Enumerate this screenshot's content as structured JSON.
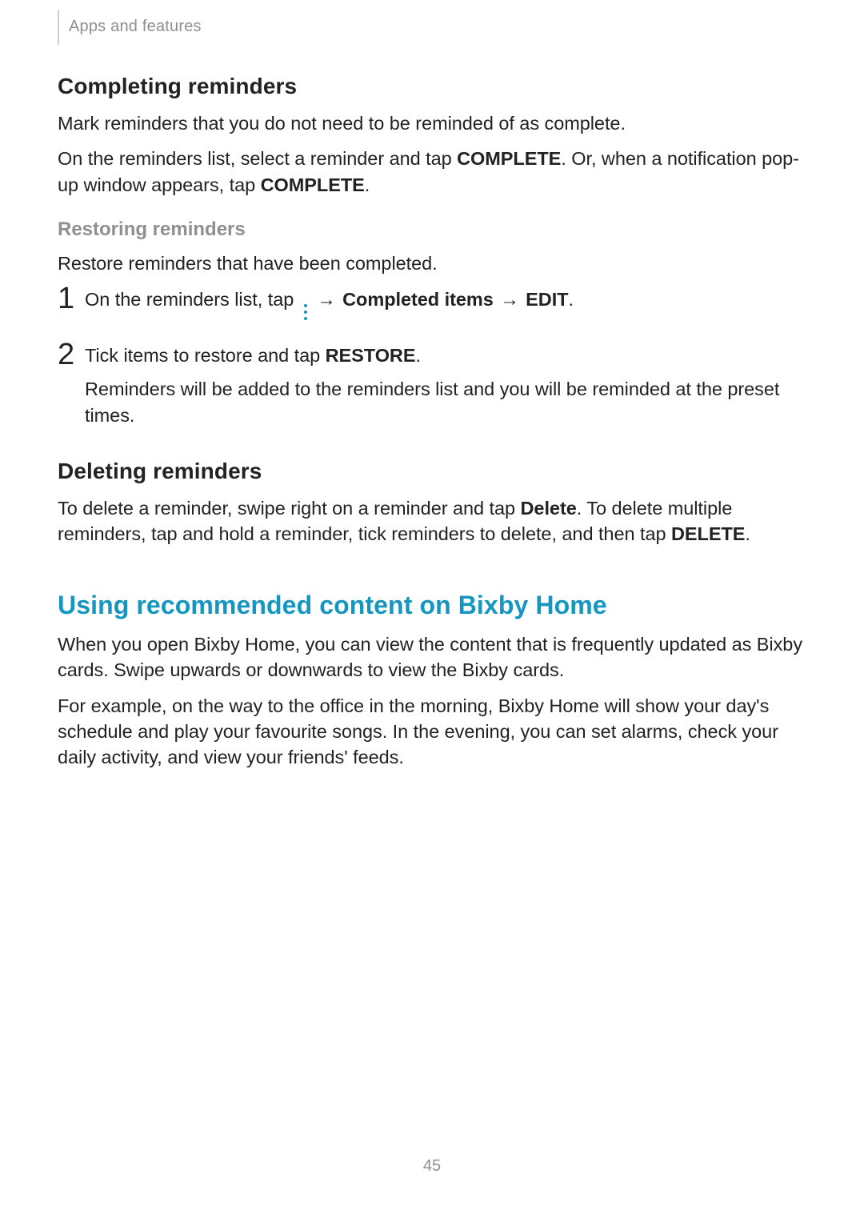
{
  "header": {
    "breadcrumb": "Apps and features"
  },
  "section_completing": {
    "title": "Completing reminders",
    "para1_pre": "Mark reminders that you do not need to be reminded of as complete.",
    "para2_pre": "On the reminders list, select a reminder and tap ",
    "para2_bold1": "COMPLETE",
    "para2_mid": ". Or, when a notification pop-up window appears, tap ",
    "para2_bold2": "COMPLETE",
    "para2_post": "."
  },
  "section_restoring": {
    "title": "Restoring reminders",
    "intro": "Restore reminders that have been completed.",
    "step1_num": "1",
    "step1_pre": "On the reminders list, tap ",
    "step1_arrow1": "→",
    "step1_bold1": "Completed items",
    "step1_arrow2": "→",
    "step1_bold2": "EDIT",
    "step1_post": ".",
    "step2_num": "2",
    "step2_line1_pre": "Tick items to restore and tap ",
    "step2_line1_bold": "RESTORE",
    "step2_line1_post": ".",
    "step2_line2": "Reminders will be added to the reminders list and you will be reminded at the preset times."
  },
  "section_deleting": {
    "title": "Deleting reminders",
    "para_pre": "To delete a reminder, swipe right on a reminder and tap ",
    "para_bold1": "Delete",
    "para_mid": ". To delete multiple reminders, tap and hold a reminder, tick reminders to delete, and then tap ",
    "para_bold2": "DELETE",
    "para_post": "."
  },
  "section_bixby": {
    "title": "Using recommended content on Bixby Home",
    "para1": "When you open Bixby Home, you can view the content that is frequently updated as Bixby cards. Swipe upwards or downwards to view the Bixby cards.",
    "para2": "For example, on the way to the office in the morning, Bixby Home will show your day's schedule and play your favourite songs. In the evening, you can set alarms, check your daily activity, and view your friends' feeds."
  },
  "footer": {
    "page_number": "45"
  }
}
